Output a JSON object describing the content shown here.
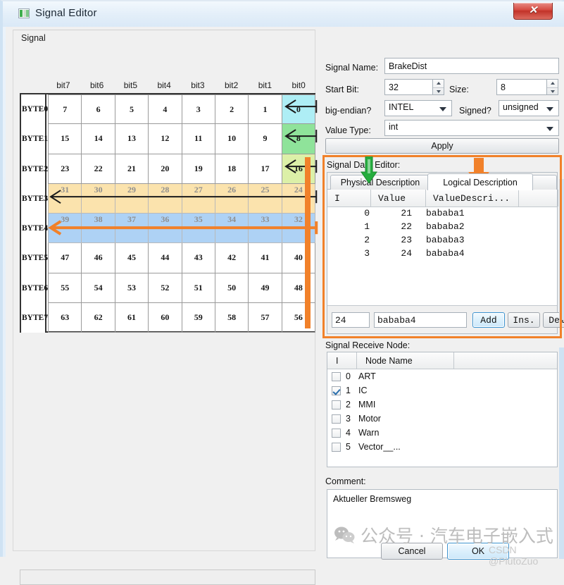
{
  "window": {
    "title": "Signal Editor",
    "close_label": "✕",
    "icon": "app-icon"
  },
  "left_group": {
    "label": "Signal",
    "bit_headers": [
      "bit7",
      "bit6",
      "bit5",
      "bit4",
      "bit3",
      "bit2",
      "bit1",
      "bit0"
    ],
    "rows": [
      {
        "label": "BYTE0",
        "bits": [
          "7",
          "6",
          "5",
          "4",
          "3",
          "2",
          "1",
          "0"
        ],
        "highlight": "#aeeef5",
        "faded": false,
        "arrow": "black-short"
      },
      {
        "label": "BYTE1",
        "bits": [
          "15",
          "14",
          "13",
          "12",
          "11",
          "10",
          "9",
          "8"
        ],
        "highlight": "#8fe39a",
        "faded": false,
        "arrow": "black-short"
      },
      {
        "label": "BYTE2",
        "bits": [
          "23",
          "22",
          "21",
          "20",
          "19",
          "18",
          "17",
          "16"
        ],
        "highlight": "#dcf0a8",
        "faded": false,
        "arrow": "black-short"
      },
      {
        "label": "BYTE3",
        "bits": [
          "31",
          "30",
          "29",
          "28",
          "27",
          "26",
          "25",
          "24"
        ],
        "highlight": "#fbe3ad",
        "faded": true,
        "arrow": "black-long"
      },
      {
        "label": "BYTE4",
        "bits": [
          "39",
          "38",
          "37",
          "36",
          "35",
          "34",
          "33",
          "32"
        ],
        "highlight": "#aed2f5",
        "faded": true,
        "arrow": "orange-long"
      },
      {
        "label": "BYTE5",
        "bits": [
          "47",
          "46",
          "45",
          "44",
          "43",
          "42",
          "41",
          "40"
        ],
        "highlight": "",
        "faded": false,
        "arrow": ""
      },
      {
        "label": "BYTE6",
        "bits": [
          "55",
          "54",
          "53",
          "52",
          "51",
          "50",
          "49",
          "48"
        ],
        "highlight": "",
        "faded": false,
        "arrow": ""
      },
      {
        "label": "BYTE7",
        "bits": [
          "63",
          "62",
          "61",
          "60",
          "59",
          "58",
          "57",
          "56"
        ],
        "highlight": "",
        "faded": false,
        "arrow": ""
      }
    ]
  },
  "form": {
    "signal_name_label": "Signal Name:",
    "signal_name_value": "BrakeDist",
    "start_bit_label": "Start Bit:",
    "start_bit_value": "32",
    "size_label": "Size:",
    "size_value": "8",
    "endian_label": "big-endian?",
    "endian_value": "INTEL",
    "signed_label": "Signed?",
    "signed_value": "unsigned",
    "value_type_label": "Value Type:",
    "value_type_value": "int",
    "apply_label": "Apply"
  },
  "signal_data_editor": {
    "label": "Signal Data Editor:",
    "tabs": [
      {
        "label": "Physical Description",
        "active": false
      },
      {
        "label": "Logical  Description",
        "active": true
      }
    ],
    "columns": [
      "I",
      "Value",
      "ValueDescri..."
    ],
    "rows": [
      {
        "i": "0",
        "value": "21",
        "desc": "bababa1"
      },
      {
        "i": "1",
        "value": "22",
        "desc": "bababa2"
      },
      {
        "i": "2",
        "value": "23",
        "desc": "bababa3"
      },
      {
        "i": "3",
        "value": "24",
        "desc": "bababa4"
      }
    ],
    "edit_value": "24",
    "edit_desc": "bababa4",
    "buttons": [
      {
        "label": "Add",
        "focus": true
      },
      {
        "label": "Ins.",
        "focus": false
      },
      {
        "label": "Del",
        "focus": false
      }
    ]
  },
  "receive_node": {
    "label": "Signal Receive Node:",
    "columns": [
      "I",
      "Node Name"
    ],
    "rows": [
      {
        "index": "0",
        "name": "ART",
        "checked": false
      },
      {
        "index": "1",
        "name": "IC",
        "checked": true
      },
      {
        "index": "2",
        "name": "MMI",
        "checked": false
      },
      {
        "index": "3",
        "name": "Motor",
        "checked": false
      },
      {
        "index": "4",
        "name": "Warn",
        "checked": false
      },
      {
        "index": "5",
        "name": "Vector__...",
        "checked": false
      }
    ]
  },
  "comment": {
    "label": "Comment:",
    "text": "Aktueller Bremsweg"
  },
  "footer": {
    "cancel_label": "Cancel",
    "ok_label": "OK"
  },
  "watermarks": {
    "wechat": "公众号 · 汽车电子嵌入式",
    "csdn": "CSDN @PlutoZuo"
  },
  "colors": {
    "accent_orange": "#f1812a",
    "accent_green": "#25ad3e",
    "title_bar": "#e4eff9",
    "close_red": "#c23228"
  }
}
